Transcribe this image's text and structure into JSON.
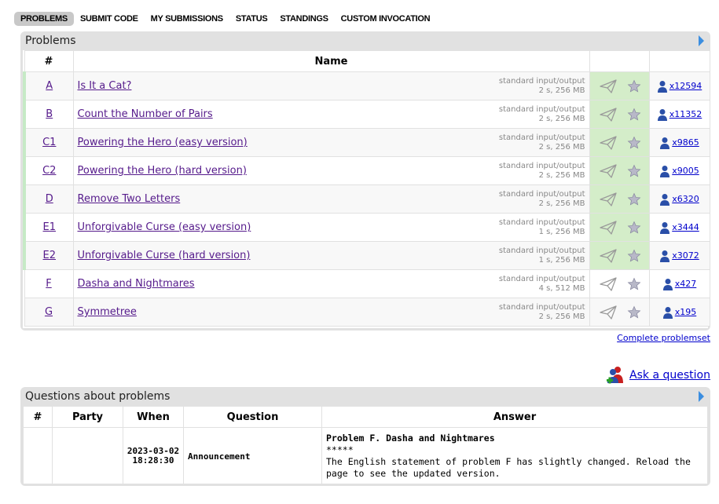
{
  "nav": [
    "PROBLEMS",
    "SUBMIT CODE",
    "MY SUBMISSIONS",
    "STATUS",
    "STANDINGS",
    "CUSTOM INVOCATION"
  ],
  "problems_panel": {
    "title": "Problems",
    "headers": {
      "index": "#",
      "name": "Name"
    },
    "rows": [
      {
        "index": "A",
        "name": "Is It a Cat?",
        "io": "standard input/output",
        "limits": "2 s, 256 MB",
        "solved": "x12594",
        "accepted": true
      },
      {
        "index": "B",
        "name": "Count the Number of Pairs",
        "io": "standard input/output",
        "limits": "2 s, 256 MB",
        "solved": "x11352",
        "accepted": true
      },
      {
        "index": "C1",
        "name": "Powering the Hero (easy version)",
        "io": "standard input/output",
        "limits": "2 s, 256 MB",
        "solved": "x9865",
        "accepted": true
      },
      {
        "index": "C2",
        "name": "Powering the Hero (hard version)",
        "io": "standard input/output",
        "limits": "2 s, 256 MB",
        "solved": "x9005",
        "accepted": true
      },
      {
        "index": "D",
        "name": "Remove Two Letters",
        "io": "standard input/output",
        "limits": "2 s, 256 MB",
        "solved": "x6320",
        "accepted": true
      },
      {
        "index": "E1",
        "name": "Unforgivable Curse (easy version)",
        "io": "standard input/output",
        "limits": "1 s, 256 MB",
        "solved": "x3444",
        "accepted": true
      },
      {
        "index": "E2",
        "name": "Unforgivable Curse (hard version)",
        "io": "standard input/output",
        "limits": "1 s, 256 MB",
        "solved": "x3072",
        "accepted": true
      },
      {
        "index": "F",
        "name": "Dasha and Nightmares",
        "io": "standard input/output",
        "limits": "4 s, 512 MB",
        "solved": "x427",
        "accepted": false
      },
      {
        "index": "G",
        "name": "Symmetree",
        "io": "standard input/output",
        "limits": "2 s, 256 MB",
        "solved": "x195",
        "accepted": false
      }
    ],
    "complete_link": "Complete problemset"
  },
  "ask_link": "Ask a question",
  "questions_panel": {
    "title": "Questions about problems",
    "headers": {
      "index": "#",
      "party": "Party",
      "when": "When",
      "question": "Question",
      "answer": "Answer"
    },
    "rows": [
      {
        "index": "",
        "party": "",
        "when_date": "2023-03-02",
        "when_time": "18:28:30",
        "question": "Announcement",
        "answer_title": "Problem F. Dasha and Nightmares",
        "answer_sep": "*****",
        "answer_body": "The English statement of problem F has slightly changed. Reload the page to see the updated version."
      }
    ]
  },
  "colors": {
    "accepted_bg": "#d4edc9",
    "accepted_border": "#c6eac6",
    "link": "#0000cc",
    "visited": "#551a8b",
    "panel": "#e1e1e1",
    "arrow": "#3b8ee0"
  }
}
